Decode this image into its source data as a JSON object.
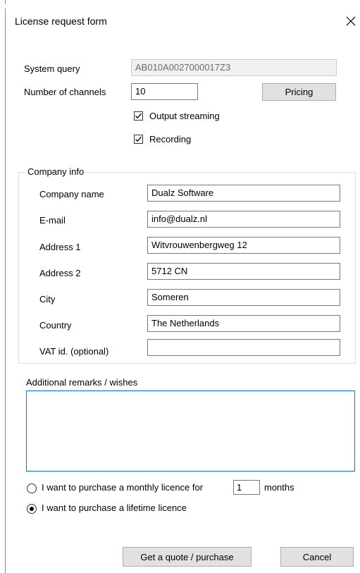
{
  "window": {
    "title": "License request form",
    "close_icon": "close-icon"
  },
  "system": {
    "query_label": "System query",
    "query_value": "AB010A0027000017Z3",
    "channels_label": "Number of channels",
    "channels_value": "10",
    "pricing_label": "Pricing",
    "output_streaming_label": "Output streaming",
    "output_streaming_checked": true,
    "recording_label": "Recording",
    "recording_checked": true
  },
  "company": {
    "group_title": "Company info",
    "fields": [
      {
        "label": "Company name",
        "value": "Dualz Software"
      },
      {
        "label": "E-mail",
        "value": "info@dualz.nl"
      },
      {
        "label": "Address 1",
        "value": "Witvrouwenbergweg 12"
      },
      {
        "label": "Address 2",
        "value": "5712 CN"
      },
      {
        "label": "City",
        "value": "Someren"
      },
      {
        "label": "Country",
        "value": "The Netherlands"
      },
      {
        "label": "VAT id. (optional)",
        "value": ""
      }
    ]
  },
  "remarks": {
    "label": "Additional remarks / wishes",
    "value": ""
  },
  "license": {
    "monthly_label": "I want to purchase a monthly licence for",
    "monthly_months": "1",
    "months_suffix": "months",
    "monthly_selected": false,
    "lifetime_label": "I want to purchase a lifetime licence",
    "lifetime_selected": true
  },
  "actions": {
    "quote_label": "Get a quote / purchase",
    "cancel_label": "Cancel"
  },
  "colors": {
    "focus_border": "#0078d7",
    "button_face": "#e1e1e1",
    "readonly_bg": "#f0f0f0"
  }
}
